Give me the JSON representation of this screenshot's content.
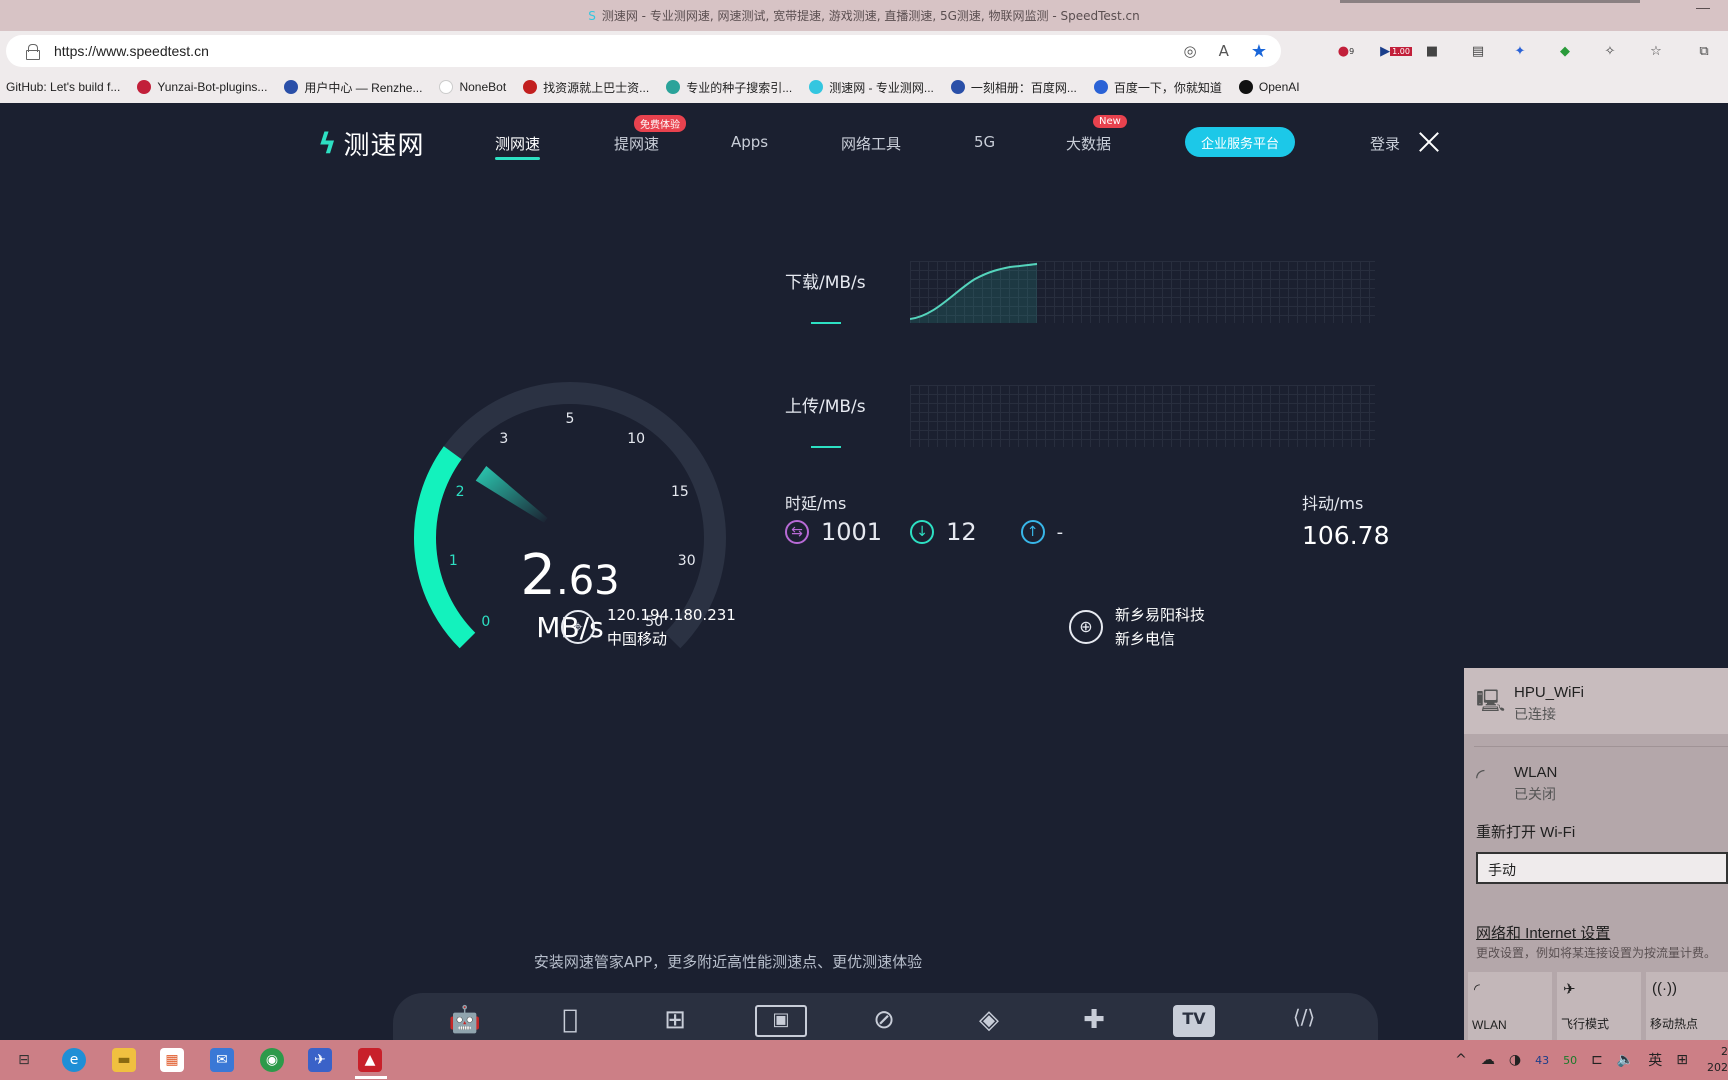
{
  "browser": {
    "title": "测速网 - 专业测网速, 网速测试, 宽带提速, 游戏测速, 直播测速, 5G测速, 物联网监测 - SpeedTest.cn",
    "url": "https://www.speedtest.cn",
    "ext_badges": {
      "ext1": "9",
      "ext2": "1.00"
    },
    "bookmarks": [
      {
        "label": "GitHub: Let's build f...",
        "color": "#1f1f1f"
      },
      {
        "label": "Yunzai-Bot-plugins...",
        "color": "#c21f3a"
      },
      {
        "label": "用户中心 — Renzhe...",
        "color": "#2a4fa8"
      },
      {
        "label": "NoneBot",
        "color": "#ffffff"
      },
      {
        "label": "找资源就上巴士资...",
        "color": "#c21f1f"
      },
      {
        "label": "专业的种子搜索引...",
        "color": "#2ba39a"
      },
      {
        "label": "测速网 - 专业测网...",
        "color": "#34c6e0"
      },
      {
        "label": "一刻相册：百度网...",
        "color": "#2a4fa8"
      },
      {
        "label": "百度一下，你就知道",
        "color": "#2a62d6"
      },
      {
        "label": "OpenAI",
        "color": "#111111"
      }
    ]
  },
  "site": {
    "logo_text": "测速网",
    "nav": [
      {
        "label": "测网速",
        "active": true
      },
      {
        "label": "提网速",
        "badge": "免费体验"
      },
      {
        "label": "Apps"
      },
      {
        "label": "网络工具"
      },
      {
        "label": "5G"
      },
      {
        "label": "大数据",
        "badge": "New"
      }
    ],
    "cta": "企业服务平台",
    "login": "登录"
  },
  "gauge": {
    "ticks": [
      "0",
      "1",
      "2",
      "3",
      "5",
      "10",
      "15",
      "30",
      "50"
    ],
    "value_int": "2",
    "value_dec": ".63",
    "unit": "MB/s",
    "fill_fraction": 0.3
  },
  "metrics": {
    "download_label": "下载/MB/s",
    "upload_label": "上传/MB/s",
    "latency_label": "时延/ms",
    "latency_value": "1001",
    "down_latency": "12",
    "up_latency": "-",
    "jitter_label": "抖动/ms",
    "jitter_value": "106.78"
  },
  "info": {
    "ip": "120.194.180.231",
    "isp": "中国移动",
    "server_name": "新乡易阳科技",
    "server_isp": "新乡电信"
  },
  "promo": "安装网速管家APP，更多附近高性能测速点、更优测速体验",
  "app_icons": [
    "android-icon",
    "apple-icon",
    "windows-icon",
    "mac-icon",
    "miniprogram-icon",
    "kodi-icon",
    "plugin-icon",
    "tv-icon",
    "code-icon"
  ],
  "tv_label": "TV",
  "network_panel": {
    "wifi_name": "HPU_WiFi",
    "wifi_status": "已连接",
    "wlan_name": "WLAN",
    "wlan_status": "已关闭",
    "reopen_label": "重新打开 Wi-Fi",
    "reopen_option": "手动",
    "settings_link": "网络和 Internet 设置",
    "settings_desc": "更改设置，例如将某连接设置为按流量计费。",
    "quick": [
      "WLAN",
      "飞行模式",
      "移动热点"
    ]
  },
  "taskbar": {
    "tray_ime": "英",
    "tray_nums": [
      "43",
      "50"
    ],
    "clock": "2\n202"
  }
}
